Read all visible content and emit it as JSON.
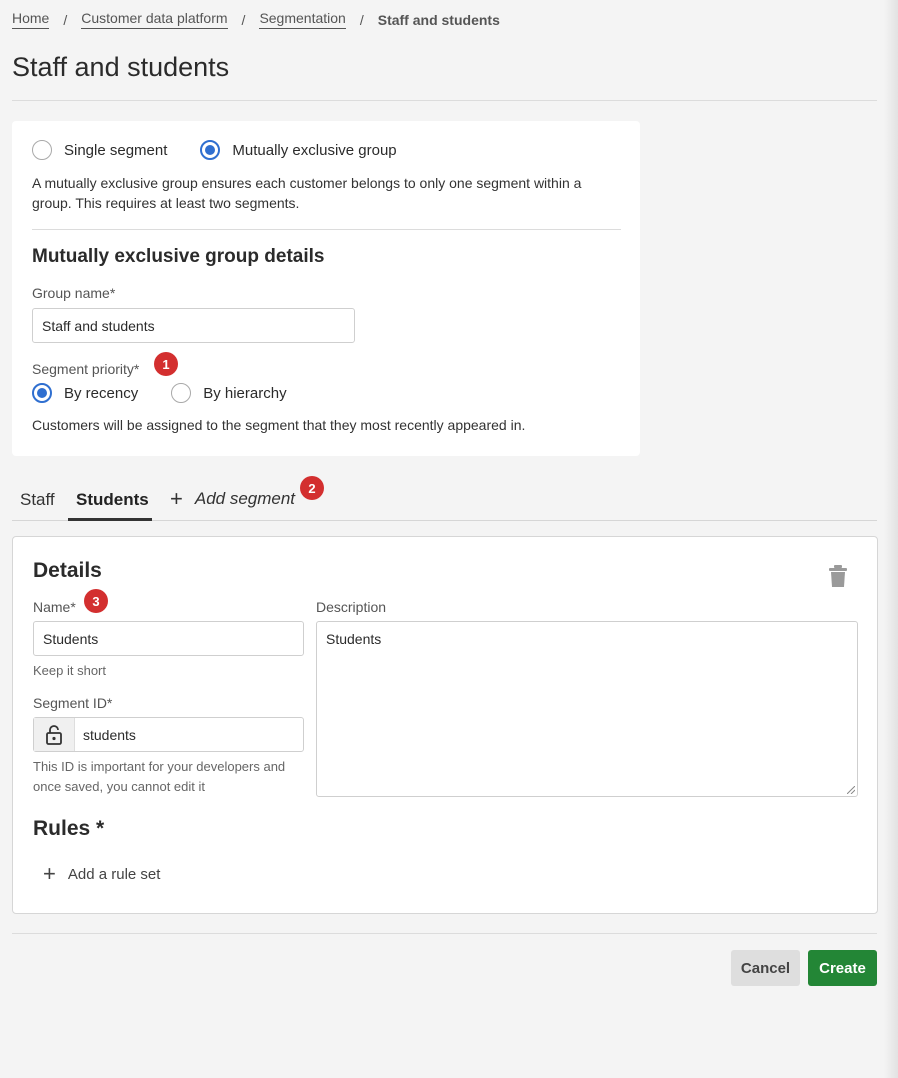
{
  "breadcrumb": {
    "items": [
      "Home",
      "Customer data platform",
      "Segmentation"
    ],
    "current": "Staff and students",
    "separator": "/"
  },
  "page": {
    "title": "Staff and students"
  },
  "group": {
    "type_options": [
      {
        "label": "Single segment",
        "checked": false
      },
      {
        "label": "Mutually exclusive group",
        "checked": true
      }
    ],
    "description": "A mutually exclusive group ensures each customer belongs to only one segment within a group. This requires at least two segments.",
    "details_heading": "Mutually exclusive group details",
    "name_label": "Group name*",
    "name_value": "Staff and students",
    "priority_label": "Segment priority*",
    "priority_options": [
      {
        "label": "By recency",
        "checked": true
      },
      {
        "label": "By hierarchy",
        "checked": false
      }
    ],
    "priority_description": "Customers will be assigned to the segment that they most recently appeared in."
  },
  "badges": [
    "1",
    "2",
    "3"
  ],
  "tabs": {
    "items": [
      {
        "label": "Staff",
        "active": false
      },
      {
        "label": "Students",
        "active": true
      }
    ],
    "add_label": "Add segment"
  },
  "segment": {
    "details_heading": "Details",
    "name_label": "Name*",
    "name_value": "Students",
    "name_hint": "Keep it short",
    "id_label": "Segment ID*",
    "id_value": "students",
    "id_hint": "This ID is important for your developers and once saved, you cannot edit it",
    "description_label": "Description",
    "description_value": "Students",
    "rules_heading": "Rules *",
    "add_rule_label": "Add a rule set"
  },
  "actions": {
    "cancel": "Cancel",
    "create": "Create"
  },
  "colors": {
    "primary": "#2f6fd0",
    "create": "#238636",
    "badge": "#d32f2f"
  },
  "icons": [
    "plus-icon",
    "trash-icon",
    "lock-icon"
  ]
}
